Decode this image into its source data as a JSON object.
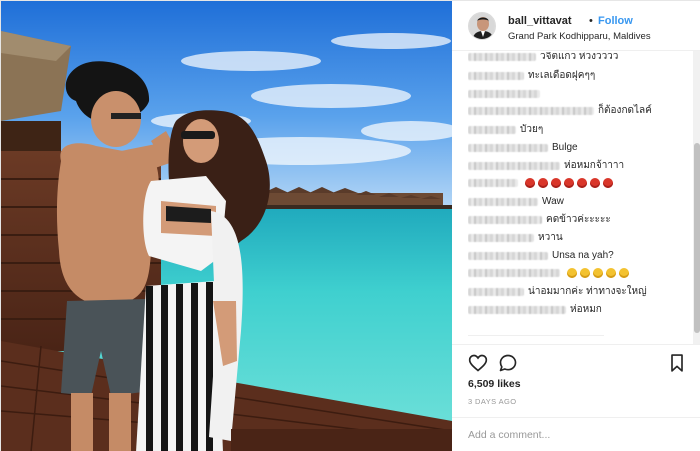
{
  "post": {
    "username": "ball_vittavat",
    "separator": "•",
    "follow_label": "Follow",
    "location": "Grand Park Kodhipparu, Maldives"
  },
  "comments": [
    {
      "text": "วจิตแกว ห่วงวววว"
    },
    {
      "text": "ทะเลเดือดฝุคๆๆ"
    },
    {
      "text": ""
    },
    {
      "text": "ก็ต้องกดไลค์"
    },
    {
      "text": "บัวยๆ"
    },
    {
      "text": "Bulge"
    },
    {
      "text": "ห่อหมกจ้าาาา"
    },
    {
      "text": "",
      "emoji": "devil",
      "emoji_count": 7
    },
    {
      "text": "Waw"
    },
    {
      "text": "คดข้าวค่ะะะะะ"
    },
    {
      "text": "หวาน"
    },
    {
      "text": "Unsa na yah?"
    },
    {
      "text": "",
      "emoji": "smile",
      "emoji_count": 5
    },
    {
      "text": "น่าอมมากค่ะ ท่าทางจะใหญ่"
    },
    {
      "text": "ห่อหมก"
    }
  ],
  "actions": {
    "like_icon": "heart-icon",
    "comment_icon": "speech-bubble-icon",
    "save_icon": "bookmark-icon"
  },
  "likes_text": "6,509 likes",
  "timestamp": "3 DAYS AGO",
  "add_comment_placeholder": "Add a comment...",
  "colors": {
    "accent": "#3897f0",
    "sea": "#3ed0d2",
    "sky": "#2f7fe0"
  }
}
